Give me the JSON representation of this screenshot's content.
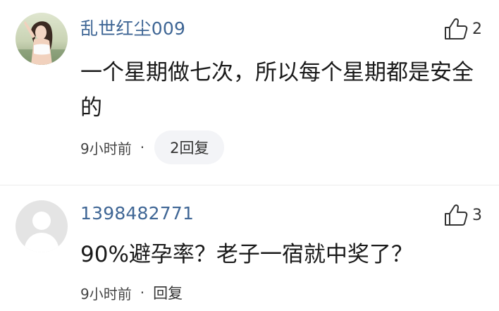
{
  "colors": {
    "username": "#3f6695",
    "text": "#1a1a1a",
    "meta": "#444444",
    "pill_bg": "#f3f4f7"
  },
  "comments": [
    {
      "username": "乱世红尘009",
      "likes": "2",
      "content": "一个星期做七次，所以每个星期都是安全的",
      "time": "9小时前",
      "separator": "·",
      "reply_label": "2回复",
      "avatar_icon": "user-photo-avatar"
    },
    {
      "username": "1398482771",
      "likes": "3",
      "content": "90%避孕率？老子一宿就中奖了？",
      "time": "9小时前",
      "separator": "·",
      "reply_label": "回复",
      "avatar_icon": "default-user-avatar"
    }
  ]
}
